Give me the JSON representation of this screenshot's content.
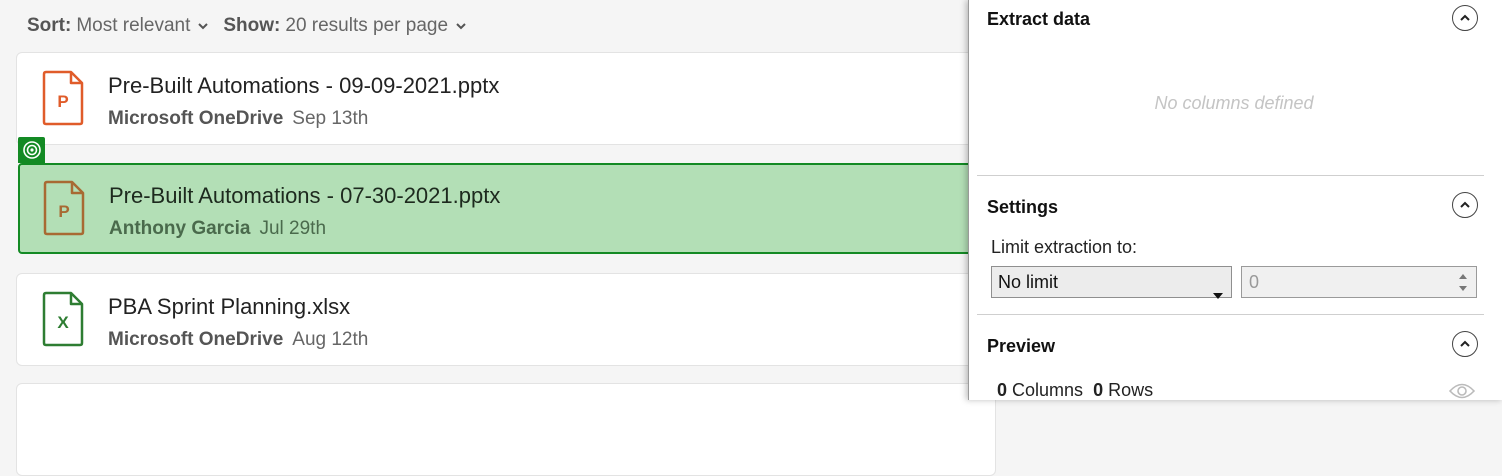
{
  "toolbar": {
    "sort_label": "Sort:",
    "sort_value": "Most relevant",
    "show_label": "Show:",
    "show_value": "20 results per page"
  },
  "results": [
    {
      "file_type": "pptx",
      "icon_letter": "P",
      "icon_color": "#e05c2a",
      "name": "Pre-Built Automations - 09-09-2021.pptx",
      "source": "Microsoft OneDrive",
      "date": "Sep 13th",
      "selected": false
    },
    {
      "file_type": "pptx",
      "icon_letter": "P",
      "icon_color": "#a86a33",
      "name": "Pre-Built Automations - 07-30-2021.pptx",
      "source": "Anthony Garcia",
      "date": "Jul 29th",
      "selected": true
    },
    {
      "file_type": "xlsx",
      "icon_letter": "X",
      "icon_color": "#2e7d32",
      "name": "PBA Sprint Planning.xlsx",
      "source": "Microsoft OneDrive",
      "date": "Aug 12th",
      "selected": false
    }
  ],
  "panel": {
    "extract": {
      "title": "Extract data",
      "empty_message": "No columns defined"
    },
    "settings": {
      "title": "Settings",
      "limit_label": "Limit extraction to:",
      "limit_select_value": "No limit",
      "limit_number_value": "0"
    },
    "preview": {
      "title": "Preview",
      "columns_count": "0",
      "columns_label": "Columns",
      "rows_count": "0",
      "rows_label": "Rows"
    }
  },
  "colors": {
    "selection_fill": "#b3dfb6",
    "selection_border": "#138a24"
  }
}
